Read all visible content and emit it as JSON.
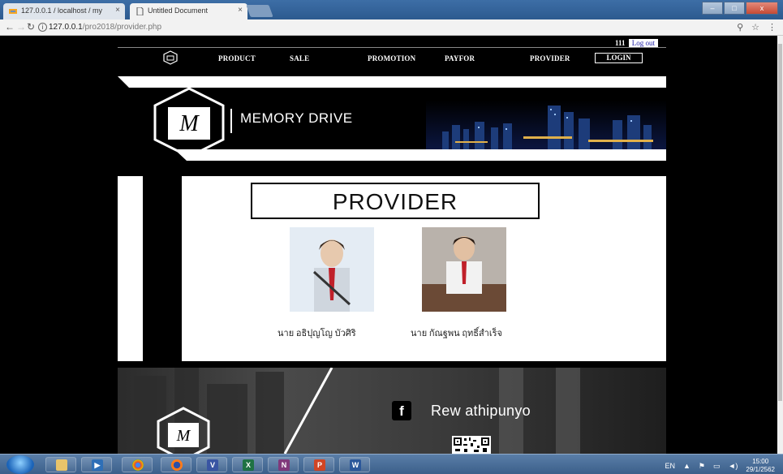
{
  "browser": {
    "tabs": [
      {
        "label": "127.0.0.1 / localhost / my",
        "active": false
      },
      {
        "label": "Untitled Document",
        "active": true
      }
    ],
    "tab_close_glyph": "×",
    "address": {
      "host": "127.0.0.1",
      "path": "/pro2018/provider.php"
    },
    "window_controls": {
      "minimize": "–",
      "maximize": "□",
      "close": "x"
    }
  },
  "header": {
    "user_id": "111",
    "logout_label": "Log out",
    "nav": [
      "PRODUCT",
      "SALE",
      "PROMOTION",
      "PAYFOR",
      "PROVIDER"
    ],
    "login_label": "LOGIN"
  },
  "banner": {
    "brand_name": "MEMORY DRIVE",
    "logo_letters": "M"
  },
  "content": {
    "title": "PROVIDER",
    "providers": [
      {
        "name": "นาย อธิปุญโญ บัวศิริ"
      },
      {
        "name": "นาย กัณฐพน ฤทธิ์สำเร็จ"
      }
    ]
  },
  "footer": {
    "facebook_glyph": "f",
    "facebook_name": "Rew athipunyo",
    "logo_letters": "M"
  },
  "taskbar": {
    "language": "EN",
    "time": "15:00",
    "date": "29/1/2562",
    "apps": [
      "explorer",
      "media",
      "chrome",
      "firefox",
      "visio",
      "excel",
      "onenote",
      "powerpoint",
      "word"
    ]
  },
  "colors": {
    "accent_link": "#1a1aa6",
    "page_bg": "#000000",
    "content_bg": "#ffffff"
  }
}
